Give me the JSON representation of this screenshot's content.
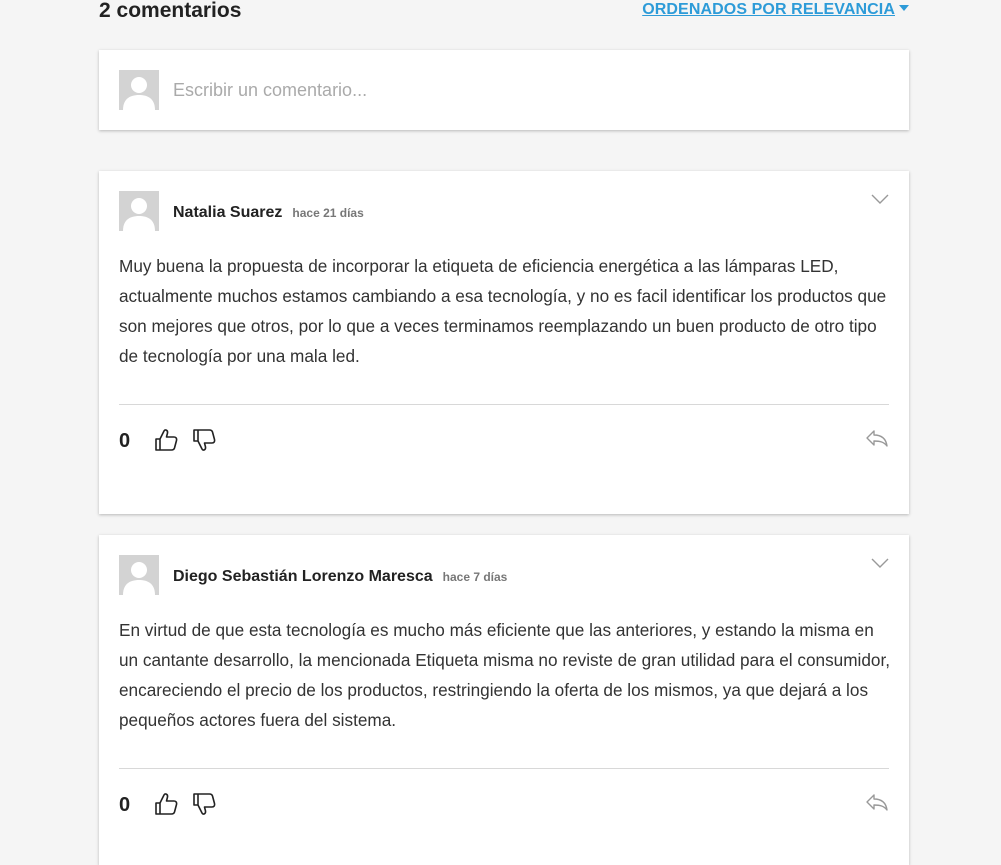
{
  "header": {
    "count_label": "2 comentarios",
    "sort_label": "ORDENADOS POR RELEVANCIA"
  },
  "composer": {
    "placeholder": "Escribir un comentario..."
  },
  "comments": [
    {
      "author": "Natalia Suarez",
      "time": "hace 21 días",
      "body": "Muy buena la propuesta de incorporar la etiqueta de eficiencia energética a las lámparas LED, actualmente muchos estamos cambiando a esa tecnología, y no es facil identificar los productos que son mejores que otros, por lo que a veces terminamos reemplazando un buen producto de otro tipo de tecnología por una mala led.",
      "votes": "0"
    },
    {
      "author": "Diego Sebastián Lorenzo Maresca",
      "time": "hace 7 días",
      "body": "En virtud de que esta tecnología es mucho más eficiente que las anteriores, y estando la misma en un cantante desarrollo, la mencionada Etiqueta misma no reviste de gran utilidad para el consumidor, encareciendo el precio de los productos, restringiendo la oferta de los mismos, ya que dejará a los pequeños actores fuera del sistema.",
      "votes": "0"
    }
  ],
  "icons": {
    "avatar": "default-user-avatar-icon",
    "sort_caret": "caret-down-icon",
    "menu": "chevron-down-icon",
    "upvote": "thumbs-up-icon",
    "downvote": "thumbs-down-icon",
    "reply": "reply-arrow-icon"
  },
  "colors": {
    "accent": "#2d9bd8",
    "background": "#f5f5f5",
    "card": "#ffffff",
    "avatar": "#d3d3d3"
  }
}
